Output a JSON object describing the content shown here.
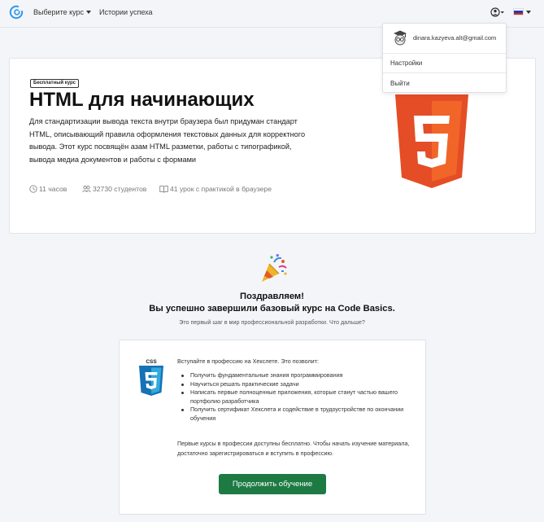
{
  "nav": {
    "courses_label": "Выберите курс",
    "success_label": "Истории успеха"
  },
  "dropdown": {
    "email": "dinara.kazyeva.alt@gmail.com",
    "settings": "Настройки",
    "logout": "Выйти"
  },
  "course": {
    "badge": "Бесплатный курс",
    "title": "HTML для начинающих",
    "description": "Для стандартизации вывода текста внутри браузера был придуман стандарт HTML, описывающий правила оформления текстовых данных для корректного вывода. Этот курс посвящён азам HTML разметки, работы с типографикой, вывода медиа документов и работы с формами",
    "hours": "11 часов",
    "students": "32730 студентов",
    "lessons": "41 урок с практикой в браузере"
  },
  "congrats": {
    "title": "Поздравляем!",
    "subtitle": "Вы успешно завершили базовый курс на Code Basics.",
    "note": "Это первый шаг в мир профессиональной разработки. Что дальше?"
  },
  "card": {
    "intro": "Вступайте в профессию на Хекслете. Это позволит:",
    "items": [
      "Получить фундаментальные знания программирования",
      "Научиться решать практические задачи",
      "Написать первые полноценные приложения, которые станут частью вашего портфолио разработчика",
      "Получить сертификат Хекслета и содействие в трудоустройстве по окончании обучения"
    ],
    "footer": "Первые курсы в профессии доступны бесплатно. Чтобы начать изучение материала, достаточно зарегистрироваться и вступить в профессию.",
    "cta": "Продолжить обучение"
  },
  "colors": {
    "html5_orange": "#e44d26",
    "html5_light": "#f16529",
    "css3_blue": "#1572b6",
    "cta_green": "#1d7a43"
  },
  "icons": {
    "logo": "hexlet-logo-icon",
    "user": "user-icon",
    "flag": "russian-flag-icon",
    "clock": "clock-icon",
    "students": "students-icon",
    "book": "book-icon",
    "party": "party-popper-icon"
  }
}
